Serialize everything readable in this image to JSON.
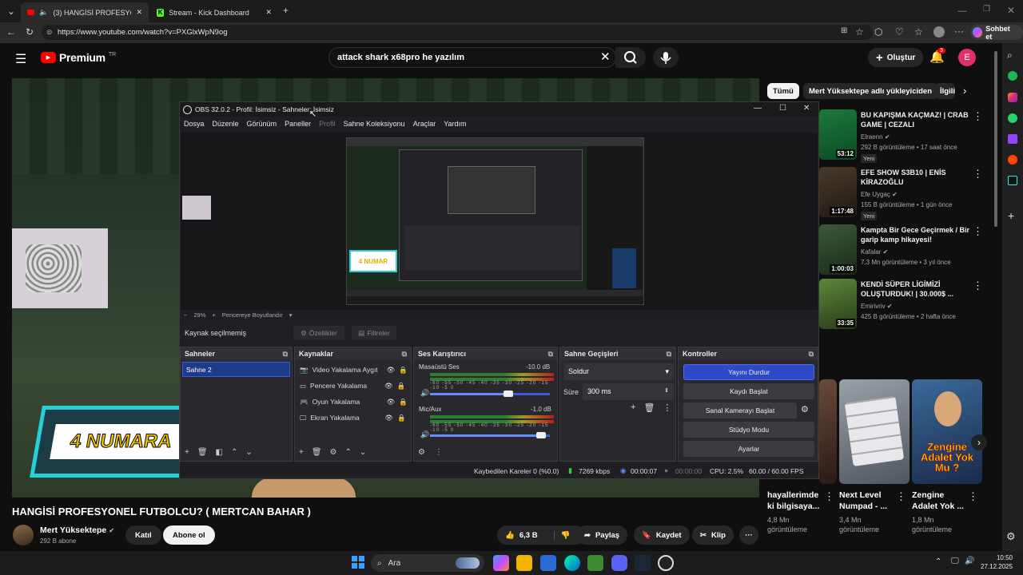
{
  "browser": {
    "tabs": [
      {
        "title": "(3) HANGİSİ PROFESYONEL FU",
        "active": true
      },
      {
        "title": "Stream - Kick Dashboard",
        "active": false
      }
    ],
    "url": "https://www.youtube.com/watch?v=PXGlxWpN9og",
    "copilot_label": "Sohbet et"
  },
  "youtube": {
    "logo": "Premium",
    "logo_sup": "TR",
    "search_query": "attack shark x68pro he yazılım",
    "create_label": "Oluştur",
    "notif_count": "3",
    "avatar_letter": "E",
    "chips": [
      "Tümü",
      "Mert Yüksektepe adlı yükleyiciden",
      "İlgili"
    ]
  },
  "obs": {
    "title": "OBS 32.0.2 - Profil: İsimsiz - Sahneler: İsimsiz",
    "menu": [
      "Dosya",
      "Düzenle",
      "Görünüm",
      "Paneller",
      "Profil",
      "Sahne Koleksiyonu",
      "Araçlar",
      "Yardım"
    ],
    "zoom": "29%",
    "fit_label": "Pencereye Boyutlandır",
    "no_source": "Kaynak seçilmemiş",
    "properties": "Özellikler",
    "filters": "Filtreler",
    "panels": {
      "scenes": "Sahneler",
      "sources": "Kaynaklar",
      "mixer": "Ses Karıştırıcı",
      "transitions": "Sahne Geçişleri",
      "controls": "Kontroller"
    },
    "scene_items": [
      "Sahne 2"
    ],
    "sources": [
      "Video Yakalama Aygıt",
      "Pencere Yakalama",
      "Oyun Yakalama",
      "Ekran Yakalama"
    ],
    "mixer": [
      {
        "name": "Masaüstü Ses",
        "db": "-10.0 dB",
        "level": 0.68
      },
      {
        "name": "Mic/Aux",
        "db": "-1.0 dB",
        "level": 0.95
      }
    ],
    "mixer_ticks": "-60 -55 -50 -45 -40 -35 -30 -25 -20 -15 -10 -5 0",
    "transition": {
      "type": "Soldur",
      "duration_label": "Süre",
      "duration": "300 ms"
    },
    "controls": [
      "Yayını Durdur",
      "Kaydı Başlat",
      "Sanal Kamerayı Başlat",
      "Stüdyo Modu",
      "Ayarlar"
    ],
    "status": {
      "dropped": "Kaybedilen Kareler 0 (%0.0)",
      "bitrate": "7269 kbps",
      "stream_time": "00:00:07",
      "rec_time": "00:00:00",
      "cpu": "CPU: 2.5%",
      "fps": "60.00 / 60.00 FPS"
    }
  },
  "video": {
    "overlay_text": "4 NUMARA",
    "title": "HANGİSİ PROFESYONEL FUTBOLCU? ( MERTCAN BAHAR )",
    "channel": "Mert Yüksektepe",
    "subs": "292 B abone",
    "join": "Katıl",
    "subscribe": "Abone ol",
    "likes": "6,3 B",
    "share": "Paylaş",
    "save": "Kaydet",
    "clip": "Klip"
  },
  "recommendations": [
    {
      "title": "BU KAPIŞMA KAÇMAZ! | CRAB GAME | CEZALI",
      "channel": "Elraenn",
      "meta": "292 B görüntüleme • 17 saat önce",
      "duration": "53:12",
      "badge": "Yeni",
      "color": "#1e6e3a"
    },
    {
      "title": "EFE SHOW S3B10 | ENİS KİRAZOĞLU",
      "channel": "Efe Uygaç",
      "meta": "155 B görüntüleme • 1 gün önce",
      "duration": "1:17:48",
      "badge": "Yeni",
      "color": "#3a3020"
    },
    {
      "title": "Kampta Bir Gece Geçirmek / Bir garip kamp hikayesi!",
      "channel": "Kafalar",
      "meta": "7,3 Mn görüntüleme • 3 yıl önce",
      "duration": "1:00:03",
      "badge": "",
      "color": "#2f4a2a"
    },
    {
      "title": "KENDİ SÜPER LİGİMİZİ OLUŞTURDUK! | 30.000$ ...",
      "channel": "Emirivriv",
      "meta": "425 B görüntüleme • 2 hafta önce",
      "duration": "33:35",
      "badge": "",
      "color": "#3a5a2a"
    }
  ],
  "shorts": [
    {
      "title": "hayallerimde ki bilgisaya...",
      "meta": "4,8 Mn görüntüleme",
      "color": "#4a3a2a"
    },
    {
      "title": "Next Level Numpad - ...",
      "meta": "3,4 Mn görüntüleme",
      "color": "#6a7078"
    },
    {
      "title": "Zengine Adalet Yok ...",
      "meta": "1,8 Mn görüntüleme",
      "overlay": "Zengine Adalet Yok Mu ?",
      "color": "#2a4a6a"
    }
  ],
  "taskbar": {
    "search": "Ara",
    "time": "10:50",
    "date": "27.12.2025"
  }
}
